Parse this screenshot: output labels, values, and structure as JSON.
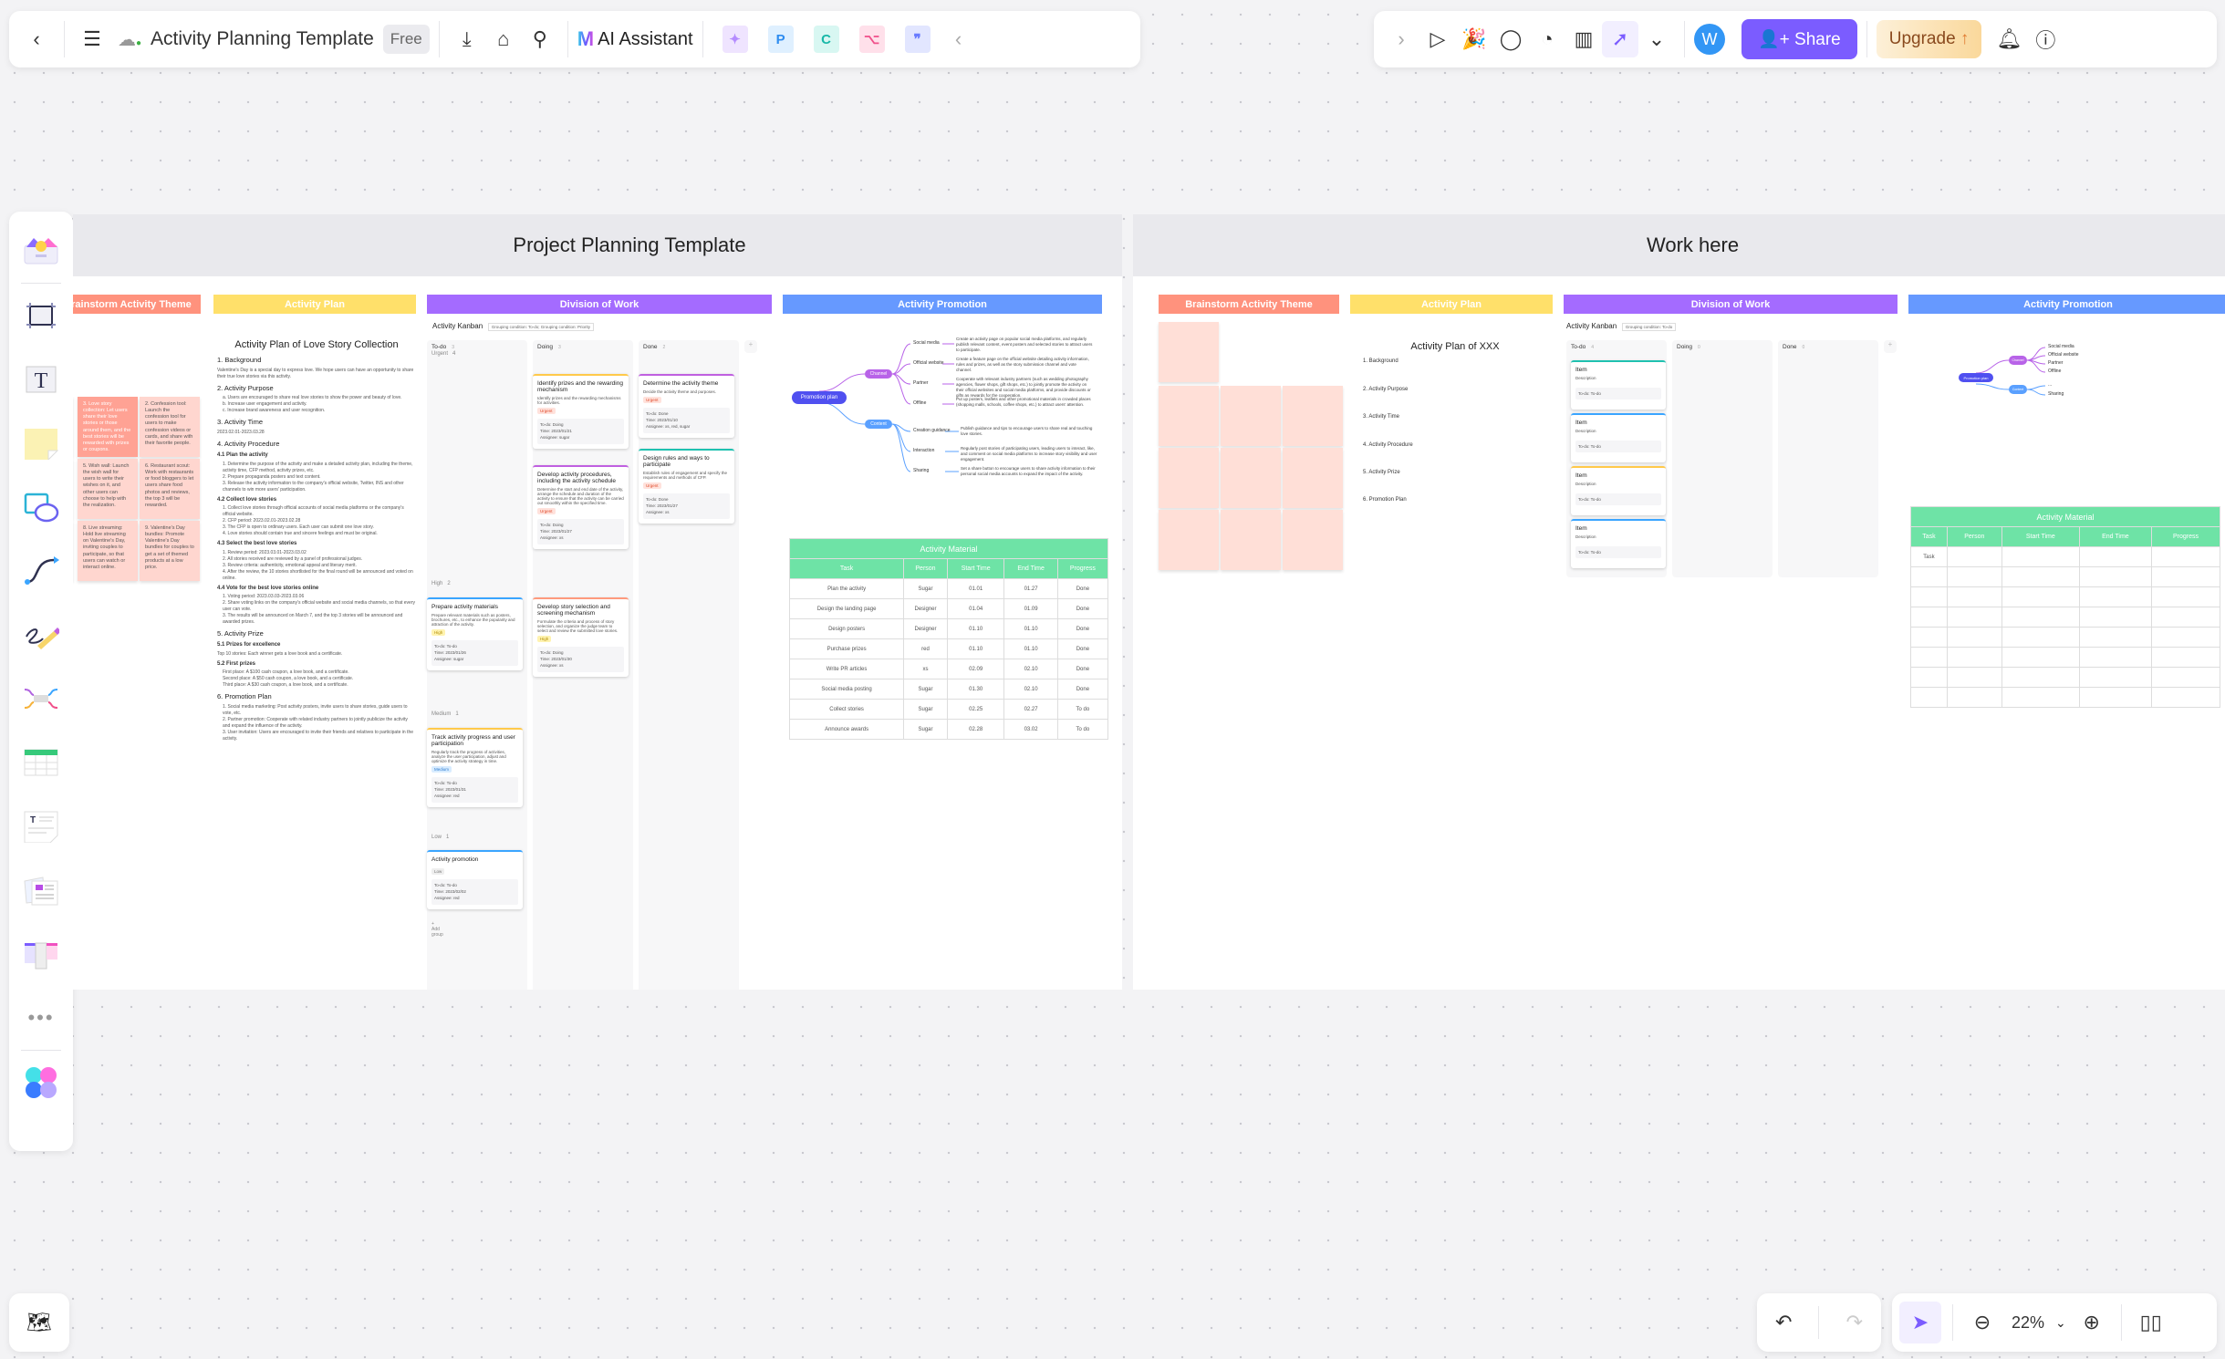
{
  "topbar": {
    "back_icon": "chevron-left-icon",
    "menu_icon": "hamburger-icon",
    "cloud_icon": "cloud-synced-icon",
    "doc_title": "Activity Planning Template",
    "plan_badge": "Free",
    "tools": [
      "download-icon",
      "tag-icon",
      "search-icon"
    ],
    "ai_label": "AI Assistant",
    "plugins": [
      {
        "name": "ai-image-plugin",
        "glyph": "✦",
        "color": "#b58cff",
        "bg": "#efe4ff"
      },
      {
        "name": "p-plugin",
        "glyph": "P",
        "color": "#2e8cf0",
        "bg": "#dff0ff"
      },
      {
        "name": "mindmap-plugin",
        "glyph": "C",
        "color": "#18b8a8",
        "bg": "#d8f7f2"
      },
      {
        "name": "flow-plugin",
        "glyph": "⌥",
        "color": "#f0508a",
        "bg": "#ffe0ea"
      },
      {
        "name": "chat-plugin",
        "glyph": "❞",
        "color": "#6a7cff",
        "bg": "#e2e6ff"
      }
    ],
    "collapse_icon": "chevron-left-icon"
  },
  "topright": {
    "expand_icon": "chevron-right-icon",
    "tools": [
      "present-icon",
      "celebrate-icon",
      "comment-icon",
      "timer-icon",
      "vote-icon",
      "laser-pointer-icon",
      "more-chevrons-icon"
    ],
    "avatar_letter": "W",
    "share_label": "Share",
    "upgrade_label": "Upgrade",
    "notification_icon": "bell-icon",
    "help_icon": "help-icon"
  },
  "left_tools": [
    "template-icon",
    "frame-icon",
    "text-icon",
    "sticky-note-icon",
    "shape-icon",
    "connector-icon",
    "pen-icon",
    "mindmap-icon",
    "table-icon",
    "text-doc-icon",
    "cards-icon",
    "kanban-icon",
    "more-icon",
    "apps-icon"
  ],
  "frames": [
    {
      "title": "Project Planning Template",
      "sections": [
        "Brainstorm Activity Theme",
        "Activity Plan",
        "Division of Work",
        "Activity Promotion"
      ],
      "stickies": [
        "3. Love story collection: Let users share their love stories or those around them, and the best stories will be rewarded with prizes or coupons.",
        "2. Confession tool: Launch the confession tool for users to make confession videos or cards, and share with their favorite people.",
        "5. Wish wall: Launch the wish wall for users to write their wishes on it, and other users can choose to help with the realization.",
        "6. Restaurant scout: Work with restaurants or food bloggers to let users share food photos and reviews, the top 3 will be rewarded.",
        "8. Live streaming: Hold live streaming on Valentine's Day, inviting couples to participate, so that users can watch or interact online.",
        "9. Valentine's Day bundles: Promote Valentine's Day bundles for couples to get a set of themed products at a low price."
      ],
      "plan": {
        "title": "Activity Plan of Love Story Collection",
        "s1": "1.  Background",
        "s1_text": "Valentine's Day is a special day to express love. We hope users can have an opportunity to share their true love stories via this activity.",
        "s2": "2.  Activity Purpose",
        "s2_items": [
          "a.  Users are encouraged to share real love stories to show the power and beauty of love.",
          "b.  Increase user engagement and activity.",
          "c.  Increase brand awareness and user recognition."
        ],
        "s3": "3.  Activity Time",
        "s3_text": "2023.02.01-2023.03.28",
        "s4": "4.  Activity Procedure",
        "s41": "4.1 Plan the activity",
        "s41_items": [
          "1. Determine the purpose of the activity and make a detailed activity plan, including the theme, activity time, CFP method, activity prizes, etc.",
          "2. Prepare propaganda posters and text content.",
          "3. Release the activity information to the company's official website, Twitter, INS and other channels to win more users' participation."
        ],
        "s42": "4.2 Collect love stories",
        "s42_items": [
          "1. Collect love stories through official accounts of social media platforms or the company's official website.",
          "2. CFP period: 2023.02.01-2023.02.28",
          "3. The CFP is open to ordinary users. Each user can submit one love story.",
          "4. Love stories should contain true and sincere feelings and must be original."
        ],
        "s43": "4.3 Select the best love stories",
        "s43_items": [
          "1. Review period: 2023.03.01-2023.03.02",
          "2. All stories received are reviewed by a panel of professional judges.",
          "3. Review criteria: authenticity, emotional appeal and literary merit.",
          "4. After the review, the 10 stories shortlisted for the final round will be announced and voted on online."
        ],
        "s44": "4.4 Vote for the best love stories online",
        "s44_items": [
          "1. Voting period: 2023.03.03-2023.03.06",
          "2. Share voting links on the company's official website and social media channels, so that every user can vote.",
          "3. The results will be announced on March 7, and the top 3 stories will be announced and awarded prizes."
        ],
        "s5": "5.  Activity Prize",
        "s51": "5.1 Prizes for excellence",
        "s51_text": "Top 10 stories: Each winner gets a love book and a certificate.",
        "s52": "5.2 First prizes",
        "s52_items": [
          "First place: A $100 cash coupon, a love book, and a certificate.",
          "Second place: A $50 cash coupon, a love book, and a certificate.",
          "Third place: A $30 cash coupon, a love book, and a certificate."
        ],
        "s6": "6. Promotion Plan",
        "s6_items": [
          "1. Social media marketing: Post activity posters, invite users to share stories, guide users to vote, etc.",
          "2. Partner promotion: Cooperate with related industry partners to jointly publicize the activity and expand the influence of the activity.",
          "3. User invitation: Users are encouraged to invite their friends and relatives to participate in the activity."
        ]
      },
      "kanban": {
        "title": "Activity Kanban",
        "grouping": "Grouping condition: To-do; Grouping condition: Priority",
        "columns": [
          {
            "label": "To-do",
            "count": "3"
          },
          {
            "label": "Doing",
            "count": "3"
          },
          {
            "label": "Done",
            "count": "2"
          }
        ],
        "groups": [
          {
            "label": "Urgent",
            "count": "4"
          },
          {
            "label": "High",
            "count": "2"
          },
          {
            "label": "Medium",
            "count": "1"
          },
          {
            "label": "Low",
            "count": "1"
          }
        ],
        "cards": [
          {
            "title": "Identify prizes and the rewarding mechanism",
            "desc": "Identify prizes and the rewarding mechanisms for activities.",
            "tag": "Urgent",
            "status": "To-do: Doing",
            "time": "Time: 2023/01/21",
            "assignee": "Assignee: sugar"
          },
          {
            "title": "Develop activity procedures, including the activity schedule",
            "desc": "Determine the start and end date of the activity, arrange the schedule and duration of the activity to ensure that the activity can be carried out smoothly within the specified time.",
            "tag": "Urgent",
            "status": "To-do: Doing",
            "time": "Time: 2023/01/27",
            "assignee": "Assignee: xs"
          },
          {
            "title": "Determine the activity theme",
            "desc": "Decide the activity theme and purposes.",
            "tag": "Urgent",
            "status": "To-do: Done",
            "time": "Time: 2023/01/10",
            "assignee": "Assignee: xs, red, sugar"
          },
          {
            "title": "Design rules and ways to participate",
            "desc": "Establish rules of engagement and specify the requirements and methods of CFP.",
            "tag": "Urgent",
            "status": "To-do: Done",
            "time": "Time: 2023/01/27",
            "assignee": "Assignee: xs"
          },
          {
            "title": "Prepare activity materials",
            "desc": "Prepare relevant materials such as posters, brochures, etc., to enhance the popularity and attraction of the activity.",
            "tag": "High",
            "status": "To-do: To-do",
            "time": "Time: 2023/01/26",
            "assignee": "Assignee: sugar"
          },
          {
            "title": "Develop story selection and screening mechanism",
            "desc": "Formulate the criteria and process of story selection, and organize the judge team to select and review the submitted love stories.",
            "tag": "High",
            "status": "To-do: Doing",
            "time": "Time: 2023/01/30",
            "assignee": "Assignee: xs"
          },
          {
            "title": "Track activity progress and user participation",
            "desc": "Regularly track the progress of activities, analyze the user participation, adjust and optimize the activity strategy in time.",
            "tag": "Medium",
            "status": "To-do: To-do",
            "time": "Time: 2023/01/31",
            "assignee": "Assignee: red"
          },
          {
            "title": "Activity promotion",
            "desc": "",
            "tag": "Low",
            "status": "To-do: To-do",
            "time": "Time: 2023/02/02",
            "assignee": "Assignee: red"
          }
        ],
        "add_group": "+ Add group"
      },
      "mindmap": {
        "root": "Promotion plan",
        "channel": "Channel",
        "content": "Content",
        "channel_leaves": [
          {
            "label": "Social media",
            "desc": "Create an activity page on popular social media platforms, and regularly publish relevant content, event posters and selected stories to attract users to participate."
          },
          {
            "label": "Official website",
            "desc": "Create a feature page on the official website detailing activity information, rules and prizes, as well as the story submission channel and vote channel."
          },
          {
            "label": "Partner",
            "desc": "Cooperate with relevant industry partners (such as wedding photography agencies, flower shops, gift shops, etc.) to jointly promote the activity on their official websites and social media platforms, and provide discounts or gifts as rewards for the cooperation."
          },
          {
            "label": "Offline",
            "desc": "Put up posters, leaflets and other promotional materials in crowded places (shopping malls, schools, coffee shops, etc.) to attract users' attention."
          }
        ],
        "content_leaves": [
          {
            "label": "Creation guidance",
            "desc": "Publish guidance and tips to encourage users to share real and touching love stories."
          },
          {
            "label": "Interaction",
            "desc": "Regularly post stories of participating users, leading users to interact, like, and comment on social media platforms to increase story visibility and user engagement."
          },
          {
            "label": "Sharing",
            "desc": "Set a share button to encourage users to share activity information to their personal social media accounts to expand the impact of the activity."
          }
        ]
      },
      "material": {
        "caption": "Activity Material",
        "headers": [
          "Task",
          "Person",
          "Start Time",
          "End Time",
          "Progress"
        ],
        "rows": [
          [
            "Plan the activity",
            "Sugar",
            "01.01",
            "01.27",
            "Done"
          ],
          [
            "Design the landing page",
            "Designer",
            "01.04",
            "01.09",
            "Done"
          ],
          [
            "Design posters",
            "Designer",
            "01.10",
            "01.10",
            "Done"
          ],
          [
            "Purchase prizes",
            "red",
            "01.10",
            "01.10",
            "Done"
          ],
          [
            "Write PR articles",
            "xs",
            "02.09",
            "02.10",
            "Done"
          ],
          [
            "Social media posting",
            "Sugar",
            "01.30",
            "02.10",
            "Done"
          ],
          [
            "Collect stories",
            "Sugar",
            "02.25",
            "02.27",
            "To do"
          ],
          [
            "Announce awards",
            "Sugar",
            "02.28",
            "03.02",
            "To do"
          ]
        ]
      }
    },
    {
      "title": "Work here",
      "sections": [
        "Brainstorm Activity Theme",
        "Activity Plan",
        "Division of Work",
        "Activity Promotion"
      ],
      "plan": {
        "title": "Activity Plan of XXX",
        "items": [
          "1.  Background",
          "2.  Activity Purpose",
          "3.  Activity Time",
          "4.  Activity Procedure",
          "5.  Activity Prize",
          "6.  Promotion Plan"
        ]
      },
      "kanban": {
        "title": "Activity Kanban",
        "grouping": "Grouping condition: To-do",
        "columns": [
          {
            "label": "To-do",
            "count": "4"
          },
          {
            "label": "Doing",
            "count": "0"
          },
          {
            "label": "Done",
            "count": "0"
          }
        ],
        "cards": [
          {
            "title": "Item",
            "desc": "Description",
            "status": "To-do: To-do"
          },
          {
            "title": "Item",
            "desc": "Description",
            "status": "To-do: To-do"
          },
          {
            "title": "Item",
            "desc": "Description",
            "status": "To-do: To-do"
          },
          {
            "title": "Item",
            "desc": "Description",
            "status": "To-do: To-do"
          }
        ]
      },
      "mindmap": {
        "root": "Promotion plan",
        "channel": "Channel",
        "content": "Content",
        "channel_leaves": [
          "Social media",
          "Official website",
          "Partner",
          "Offline"
        ],
        "content_leaves": [
          "...",
          "Sharing"
        ]
      },
      "material": {
        "caption": "Activity Material",
        "headers": [
          "Task",
          "Person",
          "Start Time",
          "End Time",
          "Progress"
        ],
        "rows": [
          [
            "Task",
            "",
            "",
            "",
            ""
          ],
          [
            "",
            "",
            "",
            "",
            ""
          ],
          [
            "",
            "",
            "",
            "",
            ""
          ],
          [
            "",
            "",
            "",
            "",
            ""
          ],
          [
            "",
            "",
            "",
            "",
            ""
          ],
          [
            "",
            "",
            "",
            "",
            ""
          ],
          [
            "",
            "",
            "",
            "",
            ""
          ],
          [
            "",
            "",
            "",
            "",
            ""
          ]
        ]
      }
    }
  ],
  "bottom": {
    "outline_icon": "outline-map-icon",
    "undo_icon": "undo-icon",
    "redo_icon": "redo-icon",
    "select_icon": "select-pointer-icon",
    "zoom_out_icon": "zoom-out-icon",
    "zoom_level": "22%",
    "zoom_in_icon": "zoom-in-icon",
    "minimap_icon": "map-icon"
  },
  "colors": {
    "accent": "#7b5cff",
    "brainstorm": "#ff927d",
    "plan": "#ffe06a",
    "division": "#a46bff",
    "promotion": "#6699ff",
    "table": "#6ee3a6",
    "channel": "#b863e8",
    "content": "#5aa0ff",
    "root": "#5050f0"
  }
}
